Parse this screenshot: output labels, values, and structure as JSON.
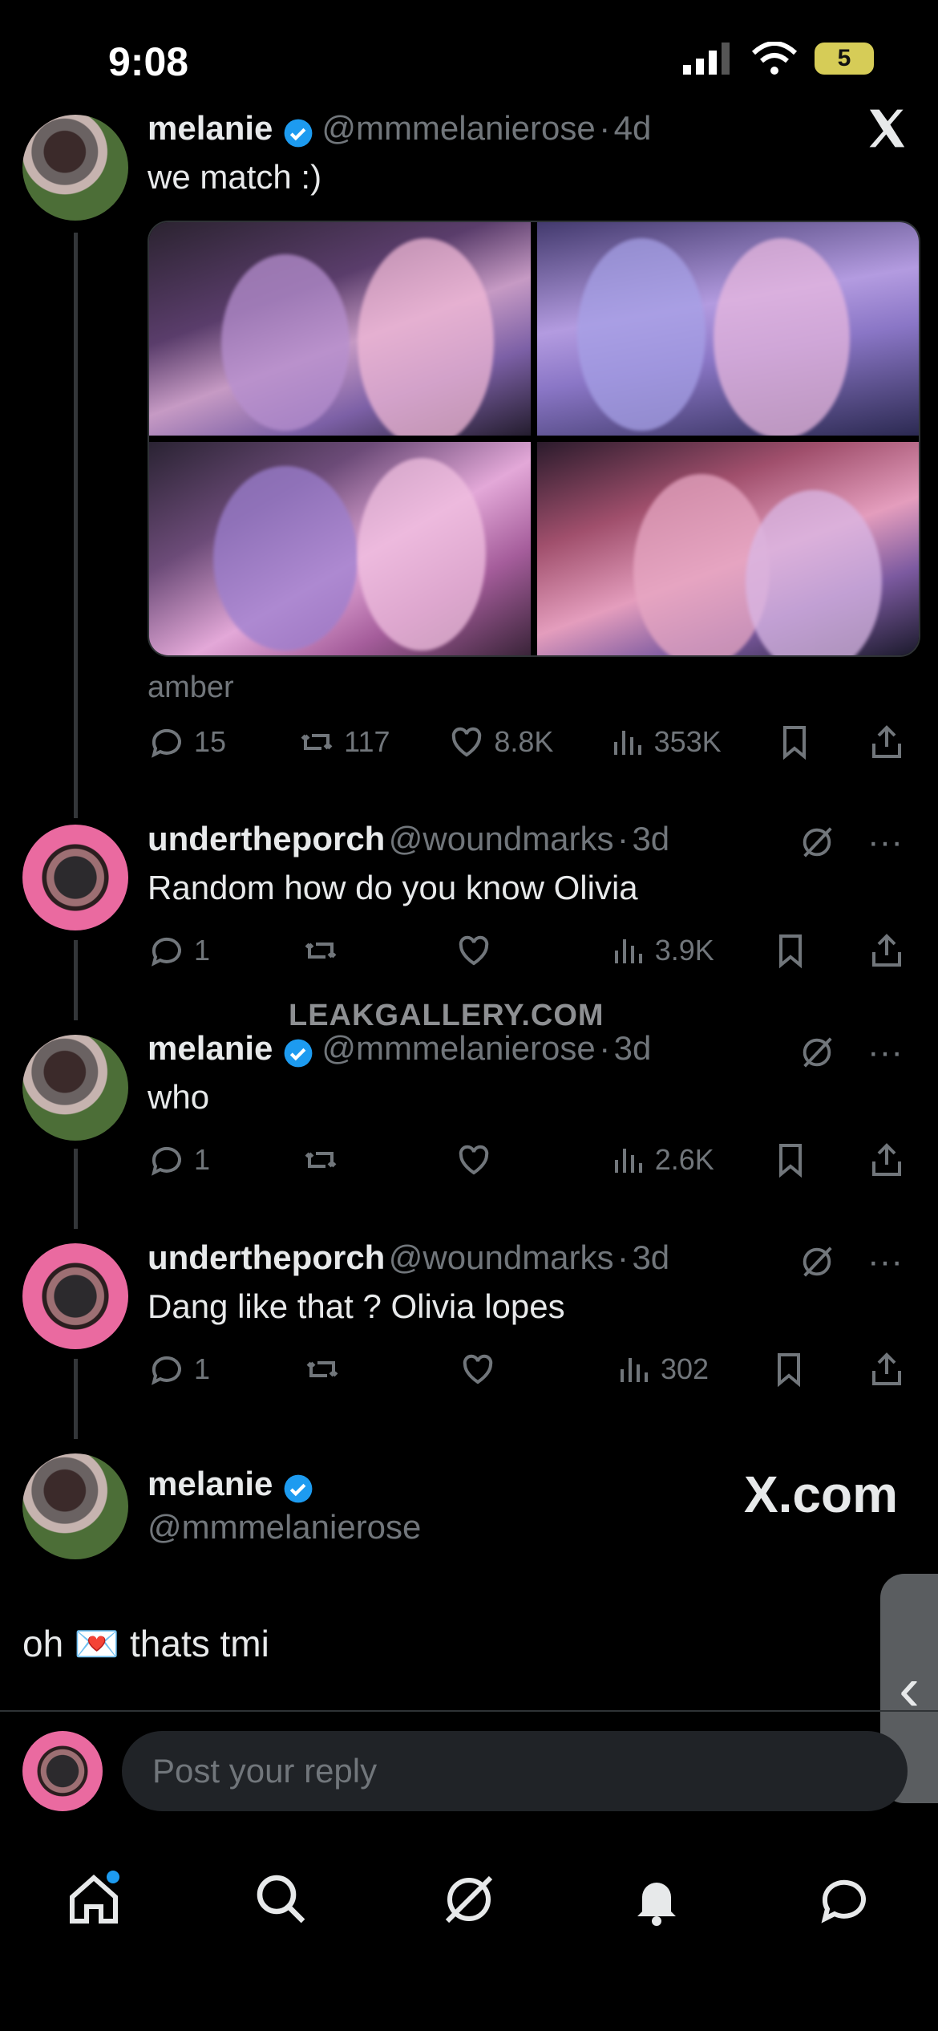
{
  "status_bar": {
    "time": "9:08",
    "battery": "5"
  },
  "posts": [
    {
      "name": "melanie",
      "handle": "@mmmelanierose",
      "time": "4d",
      "text": "we match :)",
      "tagged": "amber",
      "stats": {
        "replies": "15",
        "reposts": "117",
        "likes": "8.8K",
        "views": "353K"
      }
    },
    {
      "name": "undertheporch",
      "handle": "@woundmarks",
      "time": "3d",
      "text": "Random how do you know Olivia",
      "stats": {
        "replies": "1",
        "views": "3.9K"
      }
    },
    {
      "name": "melanie",
      "handle": "@mmmelanierose",
      "time": "3d",
      "text": "who",
      "stats": {
        "replies": "1",
        "views": "2.6K"
      }
    },
    {
      "name": "undertheporch",
      "handle": "@woundmarks",
      "time": "3d",
      "text": "Dang like that ? Olivia lopes",
      "stats": {
        "replies": "1",
        "views": "302"
      }
    }
  ],
  "focus_post": {
    "name": "melanie",
    "handle": "@mmmelanierose",
    "text_before": "oh",
    "text_after": "thats tmi",
    "emoji": "💌"
  },
  "watermark": "LEAKGALLERY.COM",
  "xcom": "X.com",
  "reply": {
    "placeholder": "Post your reply"
  },
  "colors": {
    "accent": "#1d9bf0",
    "muted": "#71767b",
    "background": "#000000"
  },
  "icons": {
    "nav": [
      "home-icon",
      "search-icon",
      "grok-icon",
      "notifications-icon",
      "messages-icon"
    ]
  }
}
